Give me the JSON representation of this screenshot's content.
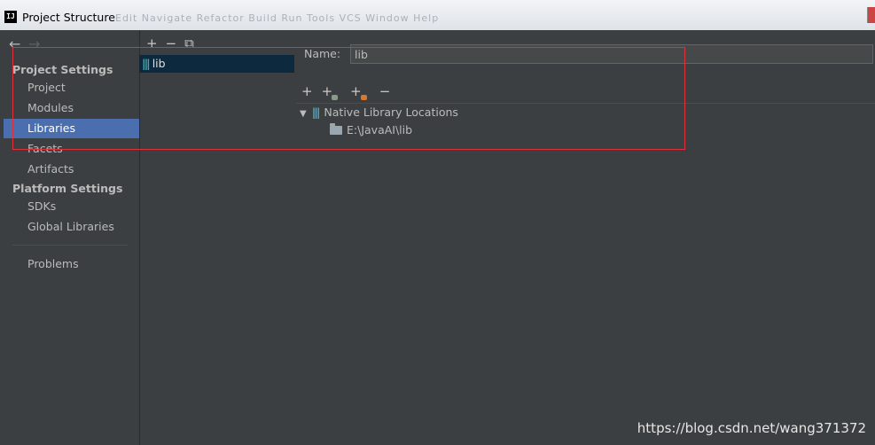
{
  "window": {
    "title": "Project Structure",
    "app_icon": "IJ",
    "menu_ghost": "Edit  Navigate  Refactor  Build  Run  Tools  VCS  Window  Help"
  },
  "nav": {
    "back": "←",
    "forward": "→"
  },
  "sidebar": {
    "project_settings_header": "Project Settings",
    "project_items": [
      "Project",
      "Modules",
      "Libraries",
      "Facets",
      "Artifacts"
    ],
    "platform_settings_header": "Platform Settings",
    "platform_items": [
      "SDKs",
      "Global Libraries"
    ],
    "problems": "Problems",
    "selected": "Libraries"
  },
  "libraries": {
    "toolbar": {
      "add": "+",
      "remove": "−",
      "copy": "⧉"
    },
    "items": [
      {
        "label": "lib",
        "icon": "library-icon"
      }
    ]
  },
  "detail": {
    "name_label": "Name:",
    "name_value": "lib",
    "toolbar": {
      "add": "+",
      "add_attach": "+",
      "add_native": "+",
      "remove": "−"
    },
    "tree": {
      "root_label": "Native Library Locations",
      "children": [
        "E:\\JavaAI\\lib"
      ]
    }
  },
  "colors": {
    "background": "#3c3f41",
    "selection": "#4b6eaf",
    "list_selection": "#0d293e",
    "annotation": "#e0303a"
  },
  "watermark": "https://blog.csdn.net/wang371372"
}
